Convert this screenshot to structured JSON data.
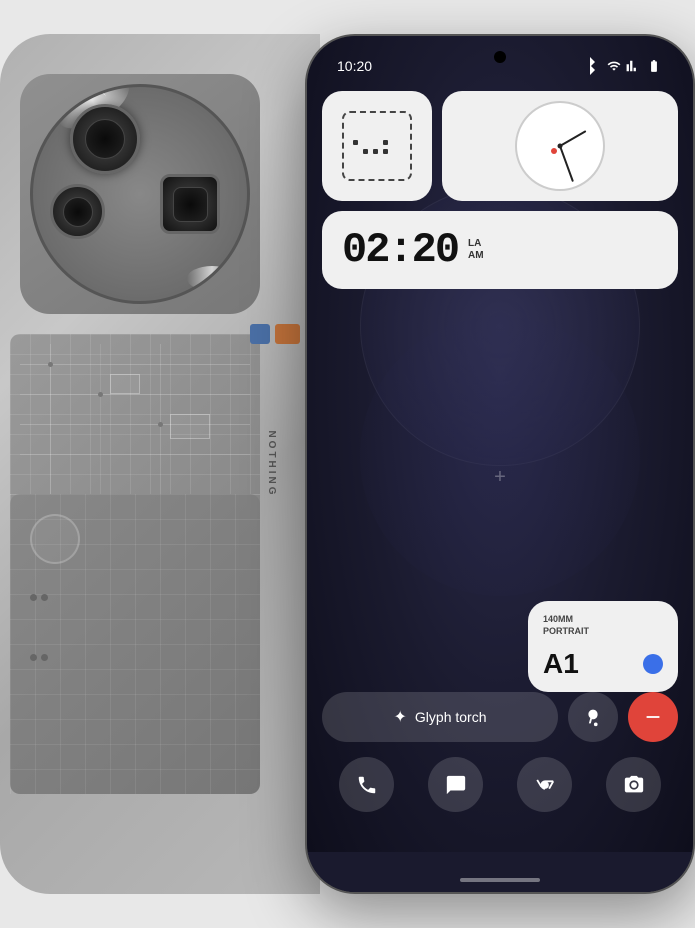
{
  "status_bar": {
    "time": "10:20",
    "icons": [
      "bluetooth",
      "wifi",
      "signal",
      "battery"
    ]
  },
  "widgets": {
    "clock_time": "02:20",
    "clock_location": "LA",
    "clock_period": "AM",
    "portrait_label_line1": "140MM",
    "portrait_label_line2": "PORTRAIT",
    "portrait_code": "A1"
  },
  "quick_settings": {
    "torch_label": "Glyph torch",
    "torch_icon": "☀",
    "hearing_icon": "🦻",
    "minus_icon": "−",
    "phone_icon": "📞",
    "chat_icon": "💬",
    "chrome_icon": "⊕",
    "camera_icon": "📷"
  },
  "nothing_brand": "NOTHING"
}
